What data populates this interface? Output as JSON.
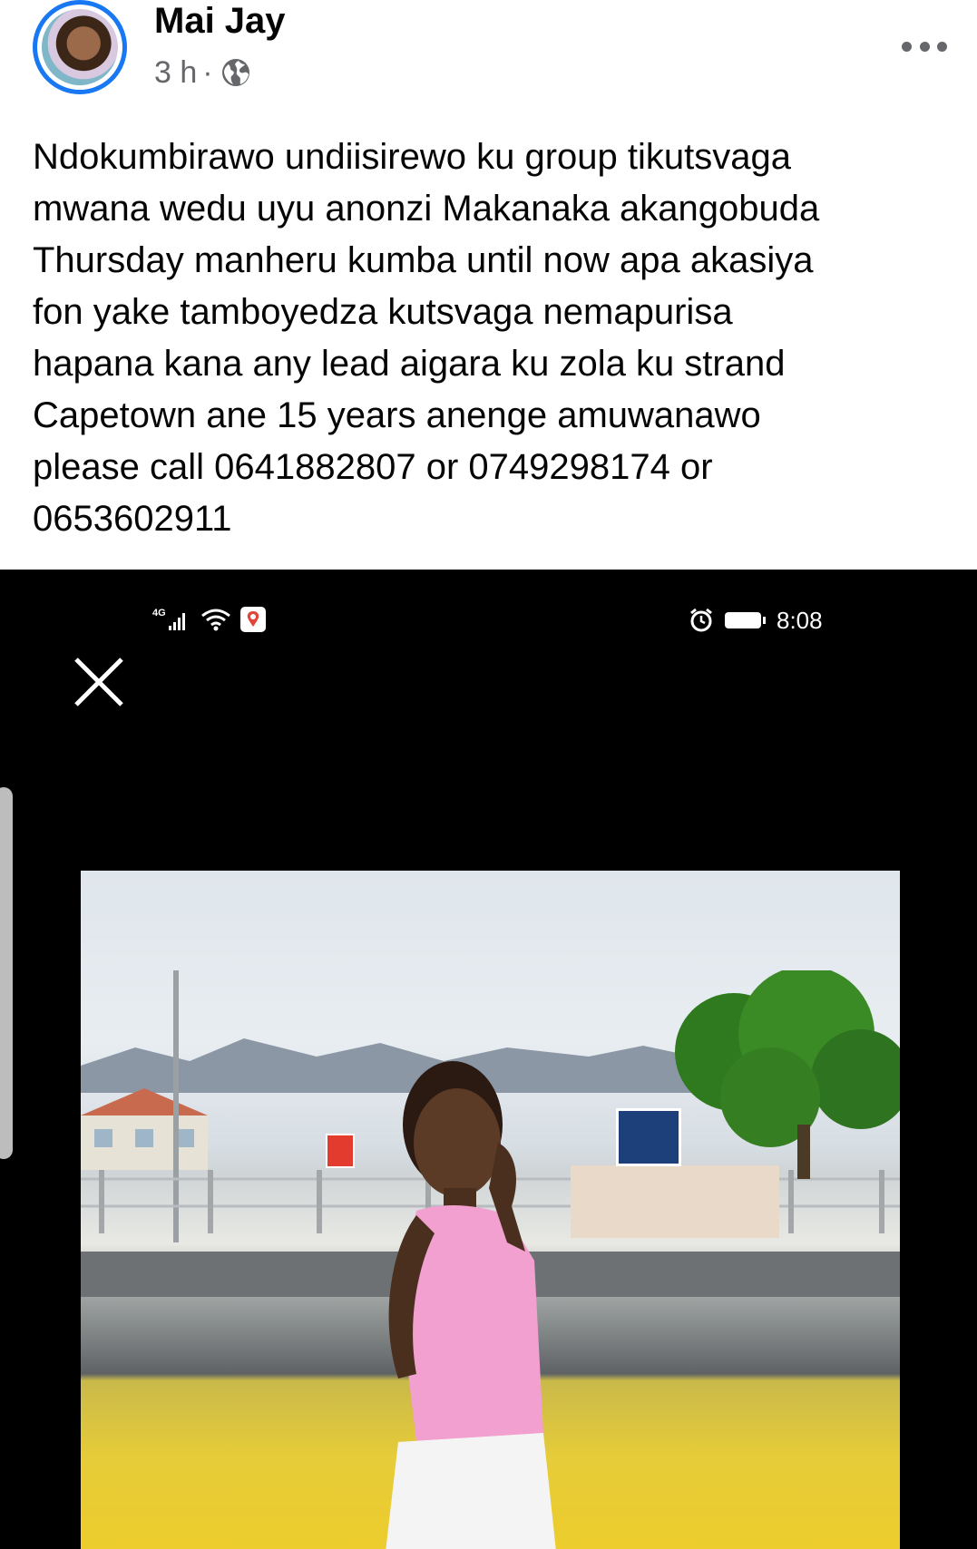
{
  "post": {
    "author": "Mai Jay",
    "time": "3 h",
    "separator": "·",
    "privacy_icon": "globe-icon",
    "more_icon": "more-options-icon",
    "text_lines": [
      "Ndokumbirawo undiisirewo ku group tikutsvaga",
      "mwana wedu uyu anonzi Makanaka akangobuda",
      "Thursday manheru kumba until now apa akasiya",
      "fon yake tamboyedza kutsvaga nemapurisa",
      "hapana kana any lead aigara ku zola ku strand",
      "Capetown ane 15 years anenge amuwanawo",
      "please call 0641882807 or 0749298174 or",
      "0653602911"
    ]
  },
  "photo": {
    "status_bar": {
      "network": "4G",
      "time": "8:08",
      "icons": [
        "signal-icon",
        "wifi-icon",
        "location-icon",
        "alarm-icon",
        "battery-icon"
      ]
    },
    "close_icon": "close-icon",
    "colors": {
      "background": "#000000",
      "shirt": "#f2a0cf",
      "grass": "#e8cc33"
    }
  },
  "colors": {
    "accent": "#1877f2",
    "text": "#050505",
    "secondary_text": "#65676b"
  }
}
